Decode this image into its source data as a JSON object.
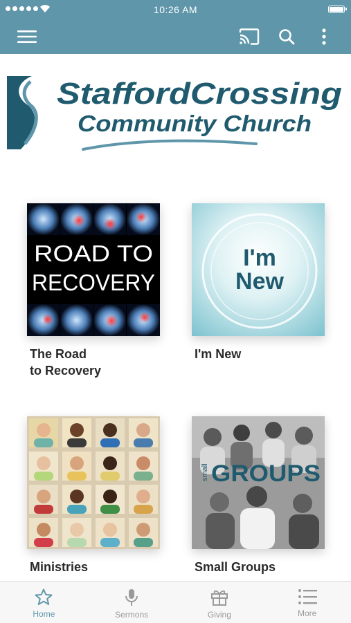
{
  "status_bar": {
    "time": "10:26 AM"
  },
  "nav": {
    "menu_icon": "hamburger-icon",
    "cast_icon": "cast-icon",
    "search_icon": "search-icon",
    "more_icon": "more-vertical-icon"
  },
  "logo": {
    "line1": "StaffordCrossing",
    "line2": "Community Church"
  },
  "tiles": [
    {
      "label": "The Road\nto Recovery",
      "art_text": [
        "ROAD TO",
        "RECOVERY"
      ]
    },
    {
      "label": "I'm New",
      "art_text": [
        "I'm",
        "New"
      ]
    },
    {
      "label": "Ministries"
    },
    {
      "label": "Small Groups",
      "art_text": [
        "small",
        "GROUPS"
      ]
    }
  ],
  "tabs": [
    {
      "label": "Home",
      "icon": "star-icon",
      "active": true
    },
    {
      "label": "Sermons",
      "icon": "microphone-icon"
    },
    {
      "label": "Giving",
      "icon": "gift-icon"
    },
    {
      "label": "More",
      "icon": "list-icon"
    }
  ],
  "colors": {
    "accent": "#5f96aa",
    "logo_dark": "#1f5a6e",
    "logo_light": "#5f96aa"
  }
}
